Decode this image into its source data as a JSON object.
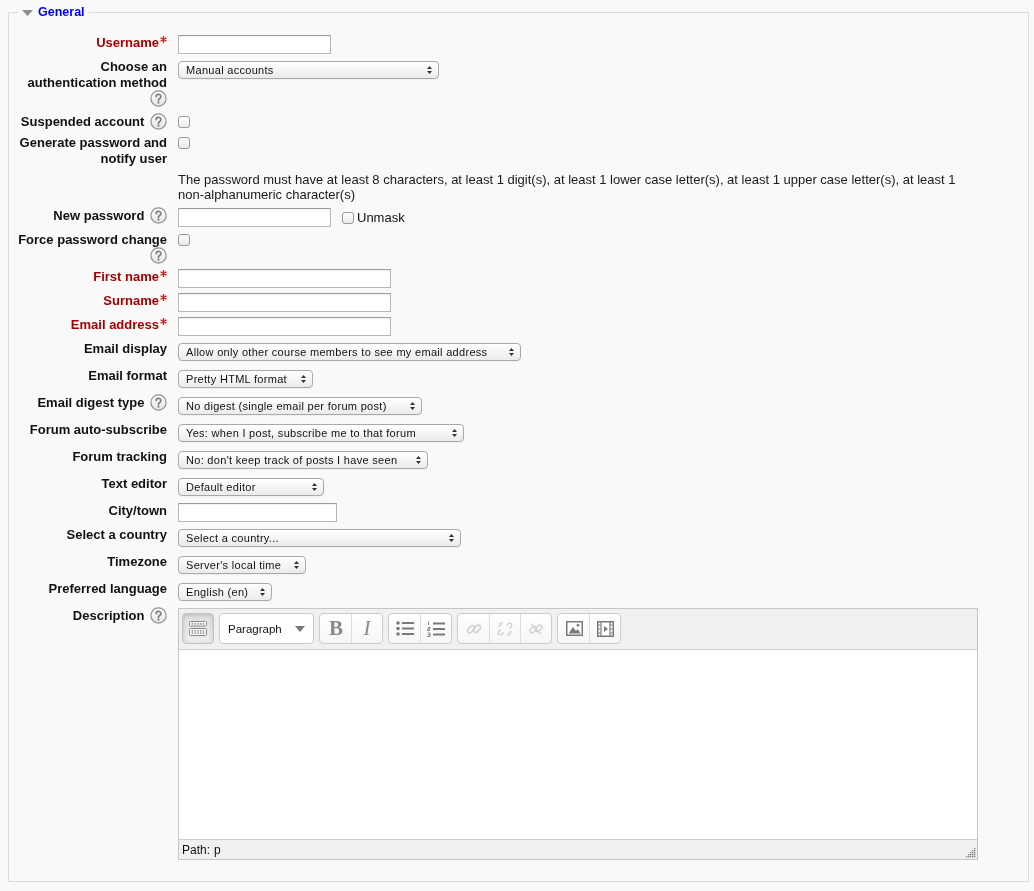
{
  "legend": {
    "title": "General",
    "expanded": true
  },
  "fields": [
    {
      "kind": "text",
      "label": "Username",
      "required": true,
      "help": false
    },
    {
      "kind": "select",
      "label": "Choose an authentication method",
      "required": false,
      "help": true,
      "value": "Manual accounts"
    },
    {
      "kind": "checkbox",
      "label": "Suspended account",
      "required": false,
      "help": true,
      "checked": false
    },
    {
      "kind": "checkbox",
      "label": "Generate password and notify user",
      "required": false,
      "help": false,
      "checked": false
    },
    {
      "kind": "note",
      "text": "The password must have at least 8 characters, at least 1 digit(s), at least 1 lower case letter(s), at least 1 upper case letter(s), at least 1 non-alphanumeric character(s)"
    },
    {
      "kind": "password",
      "label": "New password",
      "required": false,
      "help": true,
      "unmask": {
        "label": "Unmask",
        "checked": false
      }
    },
    {
      "kind": "checkbox",
      "label": "Force password change",
      "required": false,
      "help": true,
      "checked": false
    },
    {
      "kind": "text",
      "label": "First name",
      "required": true,
      "help": false
    },
    {
      "kind": "text",
      "label": "Surname",
      "required": true,
      "help": false
    },
    {
      "kind": "text",
      "label": "Email address",
      "required": true,
      "help": false
    },
    {
      "kind": "select",
      "label": "Email display",
      "required": false,
      "help": false,
      "value": "Allow only other course members to see my email address"
    },
    {
      "kind": "select",
      "label": "Email format",
      "required": false,
      "help": false,
      "value": "Pretty HTML format"
    },
    {
      "kind": "select",
      "label": "Email digest type",
      "required": false,
      "help": true,
      "value": "No digest (single email per forum post)"
    },
    {
      "kind": "select",
      "label": "Forum auto-subscribe",
      "required": false,
      "help": false,
      "value": "Yes: when I post, subscribe me to that forum"
    },
    {
      "kind": "select",
      "label": "Forum tracking",
      "required": false,
      "help": false,
      "value": "No: don't keep track of posts I have seen"
    },
    {
      "kind": "select",
      "label": "Text editor",
      "required": false,
      "help": false,
      "value": "Default editor"
    },
    {
      "kind": "text",
      "label": "City/town",
      "required": false,
      "help": false
    },
    {
      "kind": "select",
      "label": "Select a country",
      "required": false,
      "help": false,
      "value": "Select a country..."
    },
    {
      "kind": "select",
      "label": "Timezone",
      "required": false,
      "help": false,
      "value": "Server's local time"
    },
    {
      "kind": "select",
      "label": "Preferred language",
      "required": false,
      "help": false,
      "value": "English (en)"
    },
    {
      "kind": "editor",
      "label": "Description",
      "required": false,
      "help": true,
      "editor": {
        "toolbar": [
          {
            "kind": "toggle",
            "pressed": true
          },
          {
            "kind": "format",
            "value": "Paragraph"
          },
          {
            "kind": "buttons",
            "buttons": [
              {
                "kind": "bold",
                "label": "B",
                "disabled": false
              },
              {
                "kind": "italic",
                "label": "I",
                "disabled": false
              }
            ]
          },
          {
            "kind": "buttons",
            "buttons": [
              {
                "kind": "bullets",
                "disabled": false
              },
              {
                "kind": "numbering",
                "disabled": false
              }
            ]
          },
          {
            "kind": "buttons",
            "buttons": [
              {
                "kind": "link",
                "disabled": true
              },
              {
                "kind": "unlink",
                "disabled": true
              },
              {
                "kind": "nolink",
                "disabled": true
              }
            ]
          },
          {
            "kind": "buttons",
            "buttons": [
              {
                "kind": "image",
                "disabled": false
              },
              {
                "kind": "media",
                "disabled": false
              }
            ]
          }
        ],
        "path_label": "Path:",
        "path": "p"
      }
    }
  ]
}
